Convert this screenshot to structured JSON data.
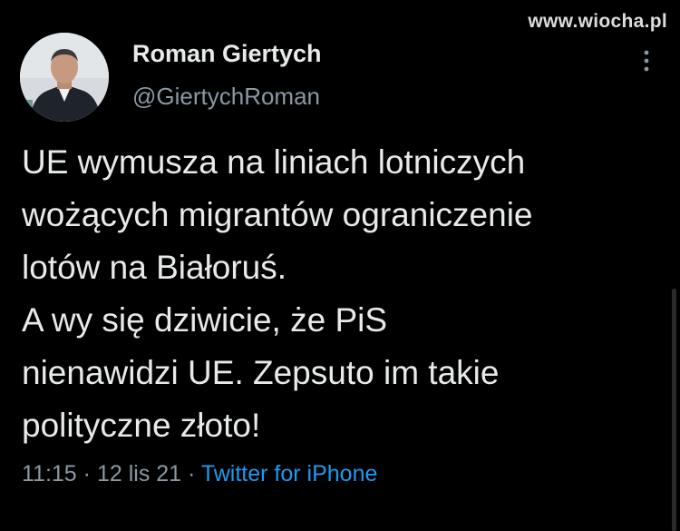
{
  "watermark": "www.wiocha.pl",
  "author": {
    "name": "Roman Giertych",
    "handle": "@GiertychRoman"
  },
  "tweet": {
    "lines": [
      "UE wymusza na liniach lotniczych",
      "wożących migrantów ograniczenie",
      "lotów na Białoruś.",
      "A wy się dziwicie, że PiS",
      "nienawidzi UE. Zepsuto im takie",
      "polityczne złoto!"
    ]
  },
  "meta": {
    "time": "11:15",
    "separator": "·",
    "date": "12 lis 21",
    "source": "Twitter for iPhone"
  },
  "colors": {
    "background": "#000000",
    "text": "#e7e9ea",
    "secondary": "#8b98a5",
    "link": "#1d9bf0"
  },
  "icons": {
    "more": "more-vertical-icon"
  }
}
